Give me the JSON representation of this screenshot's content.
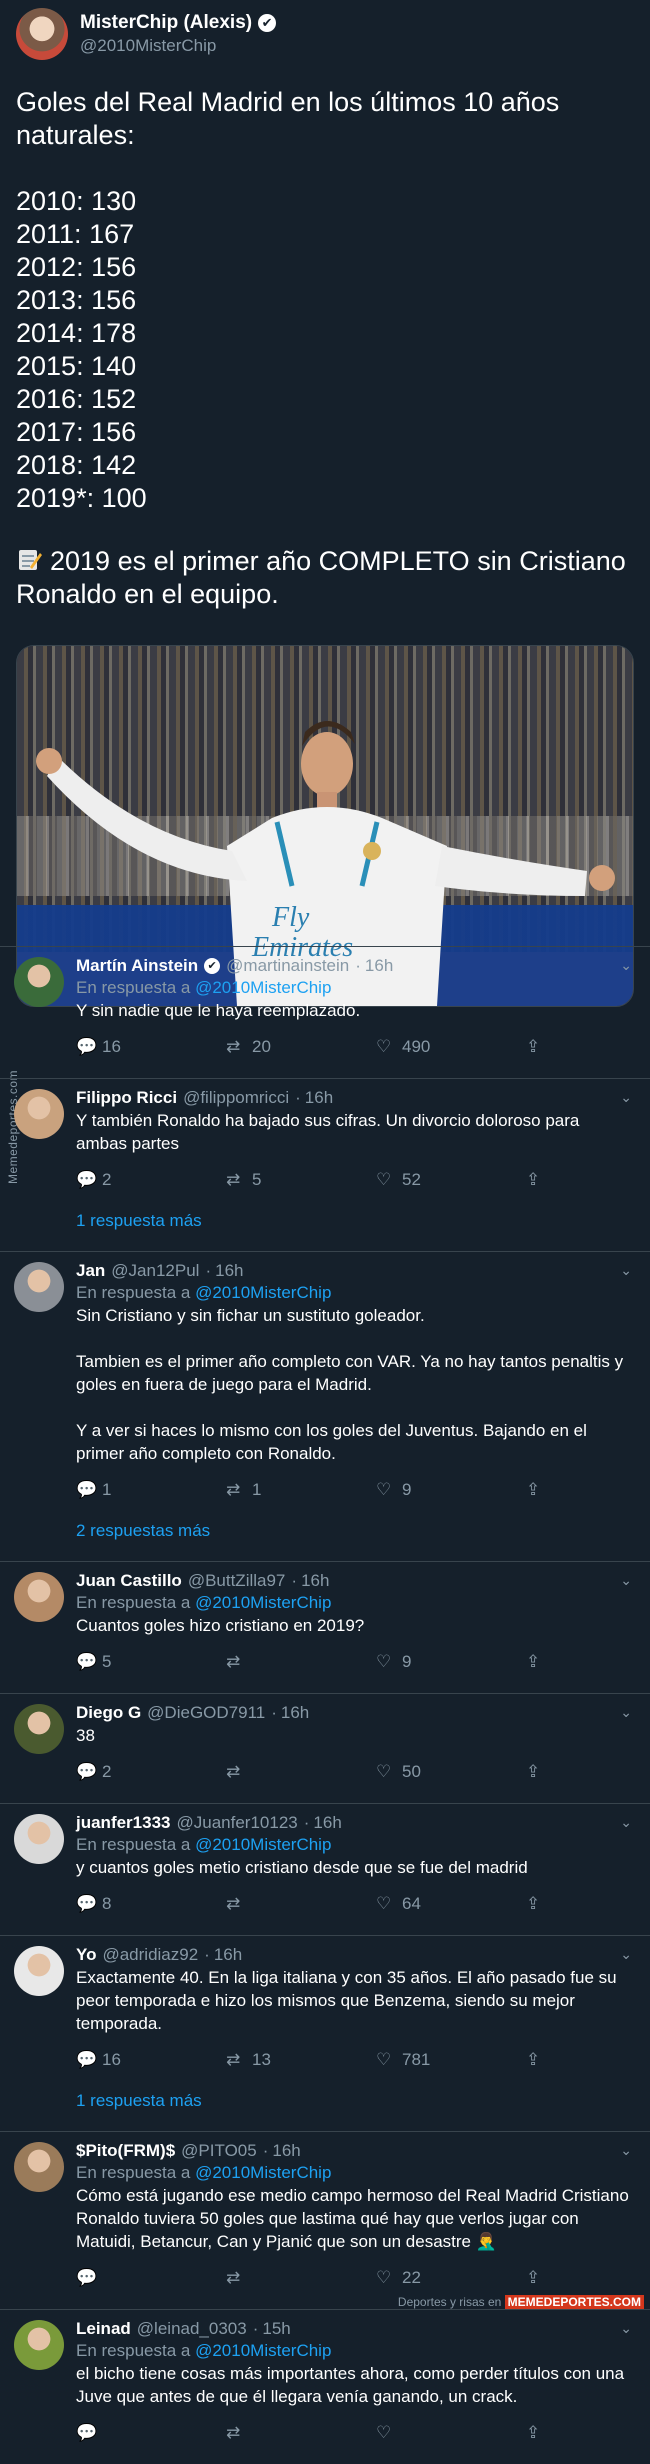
{
  "tweet": {
    "name": "MisterChip (Alexis)",
    "handle": "@2010MisterChip",
    "verified_mark": "✔",
    "text": "Goles del Real Madrid en los últimos 10 años naturales:\n\n2010: 130\n2011: 167\n2012: 156\n2013: 156\n2014: 178\n2015: 140\n2016: 152\n2017: 156\n2018: 142\n2019*: 100",
    "note": "2019 es el primer año COMPLETO sin Cristiano Ronaldo en el equipo.",
    "photo_icon": "photo-image"
  },
  "replies": [
    {
      "name": "Martín Ainstein",
      "verified": true,
      "handle": "@martinainstein",
      "time": "16h",
      "in_reply": "En respuesta a",
      "reply_to": "@2010MisterChip",
      "text": "Y sin nadie que le haya reemplazado.",
      "counts": {
        "replies": "16",
        "retweets": "20",
        "likes": "490"
      },
      "more": "",
      "avatar_color": "#3a6b3a"
    },
    {
      "name": "Filippo Ricci",
      "verified": false,
      "handle": "@filippomricci",
      "time": "16h",
      "in_reply": "",
      "reply_to": "",
      "text": "Y también Ronaldo ha bajado sus cifras. Un divorcio doloroso para ambas partes",
      "counts": {
        "replies": "2",
        "retweets": "5",
        "likes": "52"
      },
      "more": "1 respuesta más",
      "avatar_color": "#c9a27e"
    },
    {
      "name": "Jan",
      "verified": false,
      "handle": "@Jan12Pul",
      "time": "16h",
      "in_reply": "En respuesta a",
      "reply_to": "@2010MisterChip",
      "text": "Sin Cristiano y sin fichar un sustituto goleador.\n\nTambien es el primer año completo con VAR. Ya no hay tantos penaltis y goles en fuera de juego para el Madrid.\n\nY a ver si haces lo mismo con los goles del Juventus. Bajando en el primer año completo con Ronaldo.",
      "counts": {
        "replies": "1",
        "retweets": "1",
        "likes": "9"
      },
      "more": "2 respuestas más",
      "avatar_color": "#8a8f96"
    },
    {
      "name": "Juan Castillo",
      "verified": false,
      "handle": "@ButtZilla97",
      "time": "16h",
      "in_reply": "En respuesta a",
      "reply_to": "@2010MisterChip",
      "text": "Cuantos goles hizo cristiano en 2019?",
      "counts": {
        "replies": "5",
        "retweets": "",
        "likes": "9"
      },
      "more": "",
      "avatar_color": "#b48a66"
    },
    {
      "name": "Diego G",
      "verified": false,
      "handle": "@DieGOD7911",
      "time": "16h",
      "in_reply": "",
      "reply_to": "",
      "text": "38",
      "counts": {
        "replies": "2",
        "retweets": "",
        "likes": "50"
      },
      "more": "",
      "avatar_color": "#4a5a2f"
    },
    {
      "name": "juanfer1333",
      "verified": false,
      "handle": "@Juanfer10123",
      "time": "16h",
      "in_reply": "En respuesta a",
      "reply_to": "@2010MisterChip",
      "text": "y cuantos goles metio cristiano desde que se fue del madrid",
      "counts": {
        "replies": "8",
        "retweets": "",
        "likes": "64"
      },
      "more": "",
      "avatar_color": "#d9d9d9"
    },
    {
      "name": "Yo",
      "verified": false,
      "handle": "@adridiaz92",
      "time": "16h",
      "in_reply": "",
      "reply_to": "",
      "text": "Exactamente 40. En la liga italiana y con 35 años. El año pasado fue su peor temporada e hizo los mismos que Benzema, siendo su mejor temporada.",
      "counts": {
        "replies": "16",
        "retweets": "13",
        "likes": "781"
      },
      "more": "1 respuesta más",
      "avatar_color": "#e8e8e8"
    },
    {
      "name": "$Pito(FRM)$",
      "verified": false,
      "handle": "@PITO05",
      "time": "16h",
      "in_reply": "En respuesta a",
      "reply_to": "@2010MisterChip",
      "text": "Cómo está jugando ese medio campo hermoso del Real Madrid Cristiano Ronaldo tuviera 50 goles que lastima qué hay que verlos jugar con Matuidi, Betancur, Can y Pjanić que son un desastre 🤦‍♂️",
      "counts": {
        "replies": "",
        "retweets": "",
        "likes": "22"
      },
      "more": "",
      "avatar_color": "#9a7b5a"
    },
    {
      "name": "Leinad",
      "verified": false,
      "handle": "@leinad_0303",
      "time": "15h",
      "in_reply": "En respuesta a",
      "reply_to": "@2010MisterChip",
      "text": "el bicho tiene cosas más importantes ahora, como perder títulos con una Juve que antes de que él llegara venía ganando, un crack.",
      "counts": {
        "replies": "",
        "retweets": "",
        "likes": ""
      },
      "more": "",
      "avatar_color": "#7a9a3a"
    }
  ],
  "icons": {
    "reply": "reply-icon",
    "retweet": "retweet-icon",
    "like": "like-icon",
    "share": "share-icon",
    "chevron": "chevron-down-icon"
  },
  "watermark_side": "Memedeportes.com",
  "watermark_footer_pre": "Deportes y risas en",
  "watermark_footer_brand": "MEMEDEPORTES.COM",
  "colors": {
    "background": "#15202b",
    "link": "#1da1f2",
    "muted": "#8899a6",
    "divider": "#38444d"
  }
}
